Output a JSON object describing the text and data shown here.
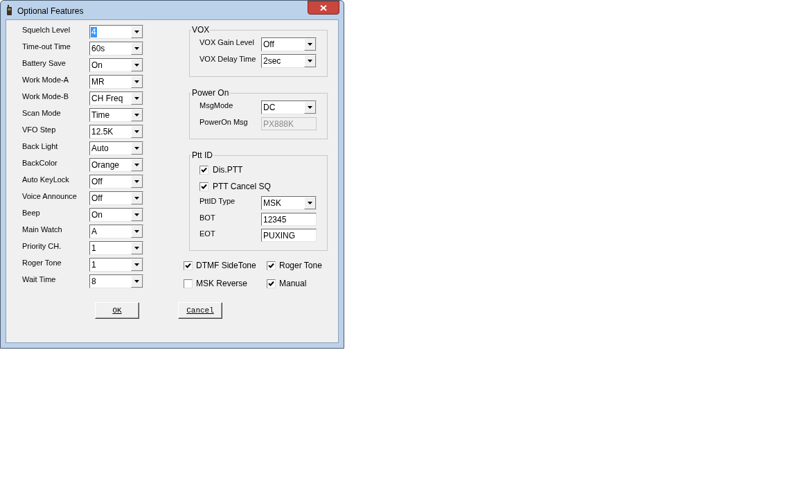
{
  "window": {
    "title": "Optional Features"
  },
  "settings": [
    {
      "label": "Squelch Level",
      "value": "4",
      "focused": true
    },
    {
      "label": "Time-out Time",
      "value": "60s",
      "focused": false
    },
    {
      "label": "Battery Save",
      "value": "On",
      "focused": false
    },
    {
      "label": "Work Mode-A",
      "value": "MR",
      "focused": false
    },
    {
      "label": "Work Mode-B",
      "value": "CH Freq",
      "focused": false
    },
    {
      "label": "Scan Mode",
      "value": "Time",
      "focused": false
    },
    {
      "label": "VFO Step",
      "value": "12.5K",
      "focused": false
    },
    {
      "label": "Back Light",
      "value": "Auto",
      "focused": false
    },
    {
      "label": "BackColor",
      "value": "Orange",
      "focused": false
    },
    {
      "label": "Auto KeyLock",
      "value": "Off",
      "focused": false
    },
    {
      "label": "Voice Announce",
      "value": "Off",
      "focused": false
    },
    {
      "label": "Beep",
      "value": "On",
      "focused": false
    },
    {
      "label": "Main Watch",
      "value": "A",
      "focused": false
    },
    {
      "label": "Priority CH.",
      "value": "1",
      "focused": false
    },
    {
      "label": "Roger Tone",
      "value": "1",
      "focused": false
    },
    {
      "label": "Wait Time",
      "value": "8",
      "focused": false
    }
  ],
  "groups": [
    {
      "title": "VOX",
      "items": [
        {
          "kind": "combo",
          "label": "VOX Gain Level",
          "value": "Off"
        },
        {
          "kind": "combo",
          "label": "VOX Delay Time",
          "value": "2sec"
        }
      ]
    },
    {
      "title": "Power On",
      "items": [
        {
          "kind": "combo",
          "label": "MsgMode",
          "value": "DC"
        },
        {
          "kind": "text",
          "label": "PowerOn Msg",
          "value": "PX888K",
          "disabled": true
        }
      ]
    },
    {
      "title": "Ptt ID",
      "items": [
        {
          "kind": "check",
          "label": "Dis.PTT",
          "checked": true
        },
        {
          "kind": "check",
          "label": "PTT Cancel SQ",
          "checked": true
        },
        {
          "kind": "combo",
          "label": "PttID Type",
          "value": "MSK"
        },
        {
          "kind": "text",
          "label": "BOT",
          "value": "12345",
          "disabled": false
        },
        {
          "kind": "text",
          "label": "EOT",
          "value": "PUXING",
          "disabled": false
        }
      ]
    }
  ],
  "options": [
    {
      "label": "DTMF SideTone",
      "checked": true
    },
    {
      "label": "Roger Tone",
      "checked": true
    },
    {
      "label": "MSK Reverse",
      "checked": false
    },
    {
      "label": "Manual",
      "checked": true
    }
  ],
  "buttons": [
    "OK",
    "Cancel"
  ]
}
